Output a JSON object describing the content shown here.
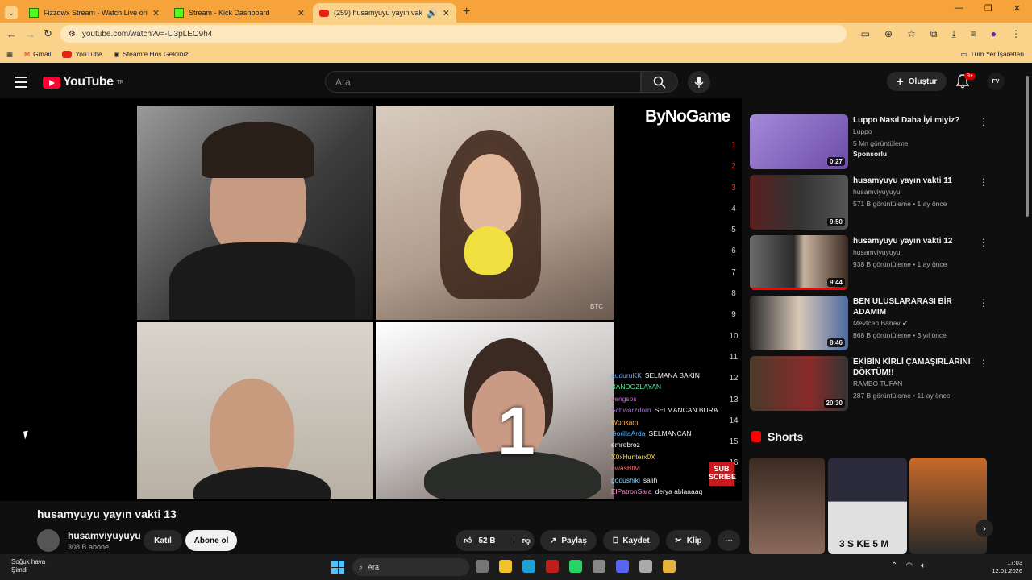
{
  "browser": {
    "tabs": [
      {
        "title": "Fizzqwx Stream - Watch Live on",
        "icon": "kick-icon"
      },
      {
        "title": "Stream - Kick Dashboard",
        "icon": "kick-icon"
      },
      {
        "title": "(259) husamyuyu yayın vakti",
        "icon": "youtube-icon"
      }
    ],
    "url": "youtube.com/watch?v=-Ll3pLEO9h4",
    "bookmarks": [
      "Gmail",
      "YouTube",
      "Steam'e Hoş Geldiniz"
    ],
    "all_bookmarks": "Tüm Yer İşaretleri"
  },
  "yt": {
    "logo_text": "YouTube",
    "region": "TR",
    "search_placeholder": "Ara",
    "create_label": "Oluştur",
    "notif_count": "9+",
    "avatar_initials": "FV"
  },
  "video": {
    "overlay_brand": "ByNoGame",
    "stream_numbers": [
      "1",
      "2",
      "3",
      "4",
      "5",
      "6",
      "7",
      "8",
      "9",
      "10",
      "11",
      "12",
      "13",
      "14",
      "15",
      "16"
    ],
    "btc_label": "BTC",
    "big_number": "1",
    "sub_badge": "SUB SCRIBE",
    "chat": [
      {
        "user": "quduruKK",
        "msg": "SELMANA BAKIN",
        "color": "#6fa8ff"
      },
      {
        "user": "BANDOZLAYAN",
        "msg": "",
        "color": "#5fe3a1"
      },
      {
        "user": "vengsos",
        "msg": "",
        "color": "#c85fd6"
      },
      {
        "user": "Schwarzdorn",
        "msg": "SELMANCAN BURA",
        "color": "#a06fd6"
      },
      {
        "user": "Wonkam",
        "msg": "",
        "color": "#ffb04f"
      },
      {
        "user": "GorillaArda",
        "msg": "SELMANCAN",
        "color": "#4fb0ff"
      },
      {
        "user": "emrebroz",
        "msg": "",
        "color": "#ffffff"
      },
      {
        "user": "X0xHunterx0X",
        "msg": "",
        "color": "#ffd84f"
      },
      {
        "user": "nwasBtlvi",
        "msg": "",
        "color": "#ff6f6f"
      },
      {
        "user": "godushiki",
        "msg": "salih",
        "color": "#8fd6ff"
      },
      {
        "user": "ElPatronSara",
        "msg": "derya ablaaaaq",
        "color": "#ff8fcf"
      }
    ],
    "title": "husamyuyu yayın vakti 13",
    "channel": "husamviyuyuyu",
    "subs": "308 B abone",
    "join_label": "Katıl",
    "subscribe_label": "Abone ol",
    "likes": "52 B",
    "share_label": "Paylaş",
    "save_label": "Kaydet",
    "clip_label": "Klip"
  },
  "sidebar": {
    "items": [
      {
        "title": "Luppo Nasıl Daha İyi miyiz?",
        "channel": "Luppo",
        "meta": "5 Mn görüntüleme",
        "extra": "Sponsorlu",
        "duration": "0:27"
      },
      {
        "title": "husamyuyu yayın vakti 11",
        "channel": "husamviyuyuyu",
        "meta": "571 B görüntüleme • 1 ay önce",
        "extra": "",
        "duration": "9:50"
      },
      {
        "title": "husamyuyu yayın vakti 12",
        "channel": "husamviyuyuyu",
        "meta": "938 B görüntüleme • 1 ay önce",
        "extra": "",
        "duration": "9:44"
      },
      {
        "title": "BEN ULUSLARARASI BİR ADAMIM",
        "channel": "Mevtcan Bahav",
        "meta": "868 B görüntüleme • 3 yıl önce",
        "extra": "",
        "duration": "8:46"
      },
      {
        "title": "EKİBİN KİRLİ ÇAMAŞIRLARINI DÖKTÜM!!",
        "channel": "RAMBO TUFAN",
        "meta": "287 B görüntüleme • 11 ay önce",
        "extra": "",
        "duration": "20:30"
      }
    ],
    "shorts_label": "Shorts",
    "shorts_caption": "3 S KE 5 M"
  },
  "taskbar": {
    "weather_title": "Soğuk hava",
    "weather_sub": "Şimdi",
    "search": "Ara",
    "time": "17:03",
    "date": "12.01.2026"
  }
}
